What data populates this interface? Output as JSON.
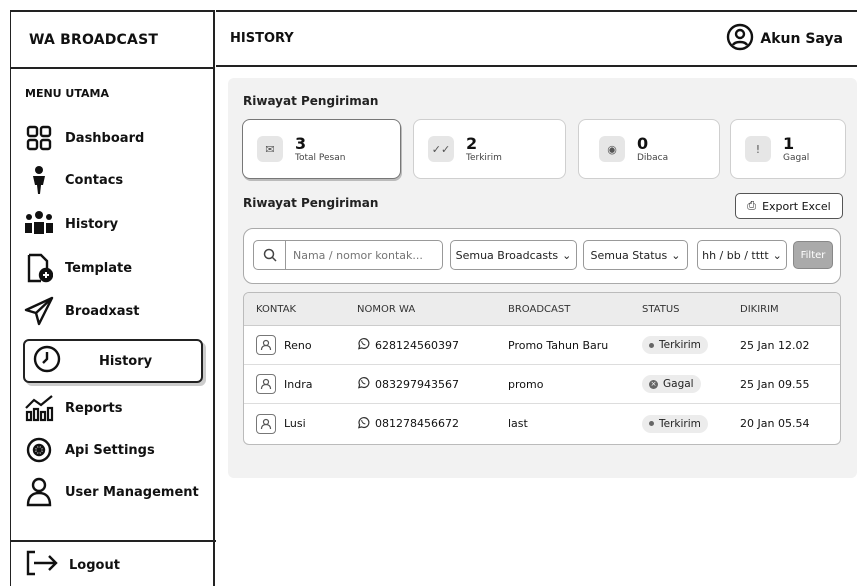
{
  "app": {
    "brand": "WA BROADCAST",
    "page_title": "HISTORY",
    "account_label": "Akun Saya"
  },
  "sidebar": {
    "menu_title": "MENU UTAMA",
    "items": [
      {
        "label": "Dashboard",
        "icon": "grid-icon"
      },
      {
        "label": "Contacs",
        "icon": "person-icon"
      },
      {
        "label": "History",
        "icon": "group-icon"
      },
      {
        "label": "Template",
        "icon": "file-add-icon"
      },
      {
        "label": "Broadxast",
        "icon": "send-icon"
      },
      {
        "label": "History",
        "icon": "clock-icon",
        "active": true
      },
      {
        "label": "Reports",
        "icon": "chart-icon"
      },
      {
        "label": "Api Settings",
        "icon": "gear-icon"
      },
      {
        "label": "User Management",
        "icon": "user-icon"
      }
    ],
    "logout": "Logout"
  },
  "main": {
    "section1_title": "Riwayat Pengiriman",
    "stats": [
      {
        "value": "3",
        "label": "Total Pesan",
        "icon": "mail-icon"
      },
      {
        "value": "2",
        "label": "Terkirim",
        "icon": "double-check-icon"
      },
      {
        "value": "0",
        "label": "Dibaca",
        "icon": "eye-icon"
      },
      {
        "value": "1",
        "label": "Gagal",
        "icon": "alert-icon"
      }
    ],
    "section2_title": "Riwayat Pengiriman",
    "export_label": "Export Excel",
    "filters": {
      "search_placeholder": "Nama / nomor kontak...",
      "broadcast_select": "Semua Broadcasts",
      "status_select": "Semua Status",
      "date_select": "hh / bb / tttt",
      "filter_button": "Filter"
    },
    "table": {
      "headers": [
        "KONTAK",
        "NOMOR WA",
        "BROADCAST",
        "STATUS",
        "DIKIRIM"
      ],
      "rows": [
        {
          "kontak": "Reno",
          "nomor": "628124560397",
          "broadcast": "Promo Tahun Baru",
          "status": "Terkirim",
          "dikirim": "25 Jan 12.02"
        },
        {
          "kontak": "Indra",
          "nomor": "083297943567",
          "broadcast": "promo",
          "status": "Gagal",
          "dikirim": "25 Jan 09.55"
        },
        {
          "kontak": "Lusi",
          "nomor": "081278456672",
          "broadcast": "last",
          "status": "Terkirim",
          "dikirim": "20 Jan 05.54"
        }
      ]
    }
  }
}
